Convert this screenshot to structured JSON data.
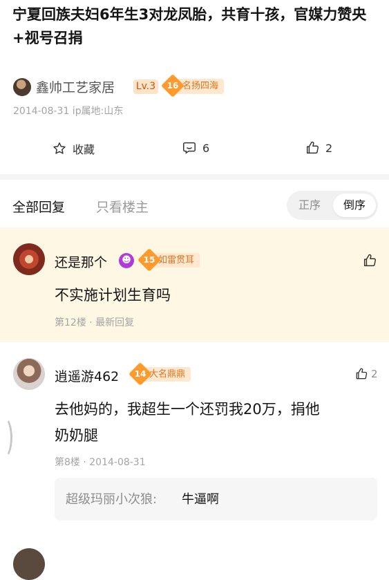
{
  "post": {
    "title": "宁夏回族夫妇6年生3对龙凤胎，共育十孩，官媒力赞央+视号召捐",
    "author": {
      "name": "鑫帅工艺家居",
      "level": "Lv.3",
      "rank_num": "16",
      "rank_title": "名扬四海"
    },
    "meta": "2014-08-31  ip属地:山东",
    "actions": {
      "favorite_label": "收藏",
      "comments_count": "6",
      "likes_count": "2"
    }
  },
  "sort": {
    "tab_all": "全部回复",
    "tab_owner": "只看楼主",
    "order_asc": "正序",
    "order_desc": "倒序"
  },
  "replies": [
    {
      "name": "还是那个",
      "rank_num": "15",
      "rank_title": "如雷贯耳",
      "content": "不实施计划生育吗",
      "meta": "第12楼 · 最新回复",
      "likes": ""
    },
    {
      "name": "逍遥游462",
      "rank_num": "14",
      "rank_title": "大名鼎鼎",
      "content_line1": "去他妈的，我超生一个还罚我20万，捐他",
      "content_line2": "奶奶腿",
      "meta": "第8楼 · 2014-08-31",
      "likes": "2",
      "sub_reply": {
        "user": "超级玛丽小次狼:",
        "text": "牛逼啊"
      }
    }
  ],
  "colors": {
    "highlight_bg": "#fdf7e3",
    "badge_orange": "#ff9a2e",
    "badge_bg": "#ffe8cf"
  }
}
